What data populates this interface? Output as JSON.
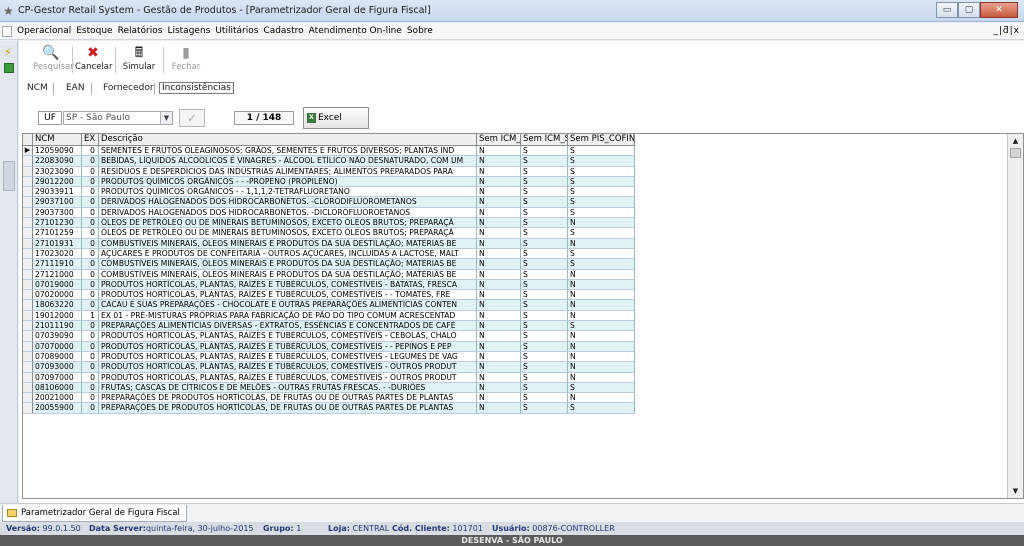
{
  "window": {
    "title": "CP-Gestor Retail System - Gestão de Produtos - [Parametrizador Geral de Figura Fiscal]",
    "buttons": [
      "▭",
      "▢",
      "✕"
    ]
  },
  "menubar": {
    "items": [
      "Operacional",
      "Estoque",
      "Relatórios",
      "Listagens",
      "Utilitários",
      "Cadastro",
      "Atendimento On-line",
      "Sobre"
    ],
    "mdi_controls": "_|ƌ|x"
  },
  "toolbar": {
    "pesquisar": "Pesquisar",
    "cancelar": "Cancelar",
    "simular": "Simular",
    "fechar": "Fechar"
  },
  "tabs": [
    "NCM",
    "EAN",
    "Fornecedor",
    "Inconsistências"
  ],
  "filter": {
    "uf_label": "UF",
    "uf_value": "SP - São Paulo",
    "counter": "1 / 148",
    "excel_label": "Excel"
  },
  "grid": {
    "headers": [
      "NCM",
      "EX",
      "Descrição",
      "Sem ICM_E",
      "Sem ICM_S",
      "Sem PIS_COFINS"
    ],
    "rows": [
      [
        "12059090",
        "0",
        "SEMENTES E FRUTOS OLEAGINOSOS; GRÃOS, SEMENTES E FRUTOS DIVERSOS; PLANTAS IND",
        "N",
        "S",
        "S"
      ],
      [
        "22083090",
        "0",
        "BEBIDAS, LÍQUIDOS ALCOÓLICOS E VINAGRES - ÁLCOOL ETÍLICO NÃO DESNATURADO, COM UM",
        "N",
        "S",
        "S"
      ],
      [
        "23023090",
        "0",
        "RESÍDUOS E DESPERDÍCIOS DAS INDÚSTRIAS ALIMENTARES; ALIMENTOS PREPARADOS PARA",
        "N",
        "S",
        "S"
      ],
      [
        "29012200",
        "0",
        "PRODUTOS QUÍMICOS ORGÂNICOS - - -PROPENO (PROPILENO)",
        "N",
        "S",
        "S"
      ],
      [
        "29033911",
        "0",
        "PRODUTOS QUÍMICOS ORGÂNICOS - - 1,1,1,2-TETRAFLUORETANO",
        "N",
        "S",
        "S"
      ],
      [
        "29037100",
        "0",
        "DERIVADOS HALOGENADOS DOS HIDROCARBONETOS. -CLORODIFLUOROMETANOS",
        "N",
        "S",
        "S"
      ],
      [
        "29037300",
        "0",
        "DERIVADOS HALOGENADOS DOS HIDROCARBONETOS. -DICLOROFLUOROETANOS",
        "N",
        "S",
        "S"
      ],
      [
        "27101230",
        "0",
        "ÓLEOS DE PETRÓLEO OU DE MINERAIS BETUMINOSOS, EXCETO ÓLEOS BRUTOS; PREPARAÇÃ",
        "N",
        "S",
        "N"
      ],
      [
        "27101259",
        "0",
        "ÓLEOS DE PETRÓLEO OU DE MINERAIS BETUMINOSOS, EXCETO ÓLEOS BRUTOS; PREPARAÇÃ",
        "N",
        "S",
        "S"
      ],
      [
        "27101931",
        "0",
        "COMBUSTÍVEIS MINERAIS, ÓLEOS MINERAIS E PRODUTOS DA SUA DESTILAÇÃO; MATÉRIAS BE",
        "N",
        "S",
        "N"
      ],
      [
        "17023020",
        "0",
        "AÇÚCARES E PRODUTOS DE CONFEITARIA - OUTROS AÇÚCARES, INCLUÍDAS A LACTOSE, MALT",
        "N",
        "S",
        "S"
      ],
      [
        "27111910",
        "0",
        "COMBUSTÍVEIS MINERAIS, ÓLEOS MINERAIS E PRODUTOS DA SUA DESTILAÇÃO; MATÉRIAS BE",
        "N",
        "S",
        "S"
      ],
      [
        "27121000",
        "0",
        "COMBUSTÍVEIS MINERAIS, ÓLEOS MINERAIS E PRODUTOS DA SUA DESTILAÇÃO; MATÉRIAS BE",
        "N",
        "S",
        "N"
      ],
      [
        "07019000",
        "0",
        "PRODUTOS HORTÍCOLAS, PLANTAS, RAÍZES E TUBÉRCULOS, COMESTÍVEIS - BATATAS, FRESCA",
        "N",
        "S",
        "N"
      ],
      [
        "07020000",
        "0",
        "PRODUTOS HORTÍCOLAS, PLANTAS, RAÍZES E TUBÉRCULOS, COMESTÍVEIS - - TOMATES, FRE",
        "N",
        "S",
        "N"
      ],
      [
        "18063220",
        "0",
        "CACAU E SUAS PREPARAÇÕES - CHOCOLATE E OUTRAS PREPARAÇÕES ALIMENTÍCIAS CONTEN",
        "N",
        "S",
        "N"
      ],
      [
        "19012000",
        "1",
        "EX 01 - PRÉ-MISTURAS PRÓPRIAS PARA FABRICAÇÃO DE PÃO DO TIPO COMUM ACRESCENTAD",
        "N",
        "S",
        "N"
      ],
      [
        "21011190",
        "0",
        "PREPARAÇÕES ALIMENTÍCIAS DIVERSAS - EXTRATOS, ESSÊNCIAS E CONCENTRADOS DE CAFÉ",
        "N",
        "S",
        "S"
      ],
      [
        "07039090",
        "0",
        "PRODUTOS HORTÍCOLAS, PLANTAS, RAÍZES E TUBÉRCULOS, COMESTÍVEIS - CEBOLAS, CHALO",
        "N",
        "S",
        "N"
      ],
      [
        "07070000",
        "0",
        "PRODUTOS HORTÍCOLAS, PLANTAS, RAÍZES E TUBÉRCULOS, COMESTÍVEIS - - PEPINOS E PEP",
        "N",
        "S",
        "N"
      ],
      [
        "07089000",
        "0",
        "PRODUTOS HORTÍCOLAS, PLANTAS, RAÍZES E TUBÉRCULOS, COMESTÍVEIS - LEGUMES DE VAG",
        "N",
        "S",
        "N"
      ],
      [
        "07093000",
        "0",
        "PRODUTOS HORTÍCOLAS, PLANTAS, RAÍZES E TUBÉRCULOS, COMESTÍVEIS - OUTROS PRODUT",
        "N",
        "S",
        "N"
      ],
      [
        "07097000",
        "0",
        "PRODUTOS HORTÍCOLAS, PLANTAS, RAÍZES E TUBÉRCULOS, COMESTÍVEIS - OUTROS PRODUT",
        "N",
        "S",
        "N"
      ],
      [
        "08106000",
        "0",
        "FRUTAS; CASCAS DE CÍTRICOS E DE MELÕES - OUTRAS FRUTAS FRESCAS. - -DURIÕES",
        "N",
        "S",
        "S"
      ],
      [
        "20021000",
        "0",
        "PREPARAÇÕES DE PRODUTOS HORTÍCOLAS, DE FRUTAS OU DE OUTRAS PARTES DE PLANTAS",
        "N",
        "S",
        "N"
      ],
      [
        "20055900",
        "0",
        "PREPARAÇÕES DE PRODUTOS HORTÍCOLAS, DE FRUTAS OU DE OUTRAS PARTES DE PLANTAS",
        "N",
        "S",
        "S"
      ]
    ]
  },
  "window_tab": "Parametrizador Geral de Figura Fiscal",
  "status": {
    "versao_label": "Versão:",
    "versao": "99.0.1.50",
    "server_label": "Data Server:",
    "server": "quinta-feira, 30-julho-2015",
    "grupo_label": "Grupo:",
    "grupo": "1",
    "loja_label": "Loja:",
    "loja": "CENTRAL",
    "cliente_label": "Cód. Cliente:",
    "cliente": "101701",
    "usuario_label": "Usuário:",
    "usuario": "00876-CONTROLLER"
  },
  "footer": "DESENVA - SÃO PAULO"
}
